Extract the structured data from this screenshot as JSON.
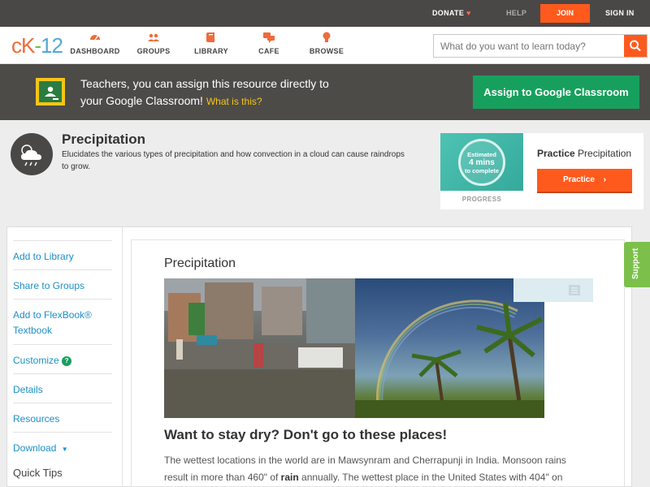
{
  "topbar": {
    "donate": "DONATE",
    "help": "HELP",
    "join": "JOIN",
    "signin": "SIGN IN"
  },
  "logo": {
    "ck": "cK",
    "dash": "-",
    "num": "12"
  },
  "nav": {
    "items": [
      {
        "label": "DASHBOARD",
        "icon": "dashboard-icon"
      },
      {
        "label": "GROUPS",
        "icon": "groups-icon"
      },
      {
        "label": "LIBRARY",
        "icon": "library-icon"
      },
      {
        "label": "CAFE",
        "icon": "cafe-icon"
      },
      {
        "label": "BROWSE",
        "icon": "browse-icon"
      }
    ],
    "search_placeholder": "What do you want to learn today?"
  },
  "banner": {
    "line1": "Teachers, you can assign this resource directly to",
    "line2": "your Google Classroom!",
    "what": "What is this?",
    "button": "Assign to Google Classroom"
  },
  "concept": {
    "title": "Precipitation",
    "description": "Elucidates the various types of precipitation and how convection in a cloud can cause raindrops to grow."
  },
  "practice": {
    "est1": "Estimated",
    "est2": "4 mins",
    "est3": "to complete",
    "progress": "PROGRESS",
    "label_bold": "Practice",
    "label_rest": "Precipitation",
    "button": "Practice"
  },
  "sidebar": {
    "items": [
      "Add to Library",
      "Share to Groups",
      "Add to FlexBook® Textbook",
      "Customize",
      "Details",
      "Resources",
      "Download"
    ],
    "quick_tips": "Quick Tips"
  },
  "article": {
    "title": "Precipitation",
    "heading": "Want to stay dry? Don't go to these places!",
    "para_a": "The wettest locations in the world are in Mawsynram and Cherrapunji in India. Monsoon rains result in more than 460\" of ",
    "para_bold": "rain",
    "para_b": " annually. The wettest place in the United States with 404\" on"
  },
  "support": "Support",
  "colors": {
    "accent": "#ff5a1e",
    "google_green": "#17a05d",
    "link": "#1c8fc7",
    "support_green": "#7cc04b"
  }
}
